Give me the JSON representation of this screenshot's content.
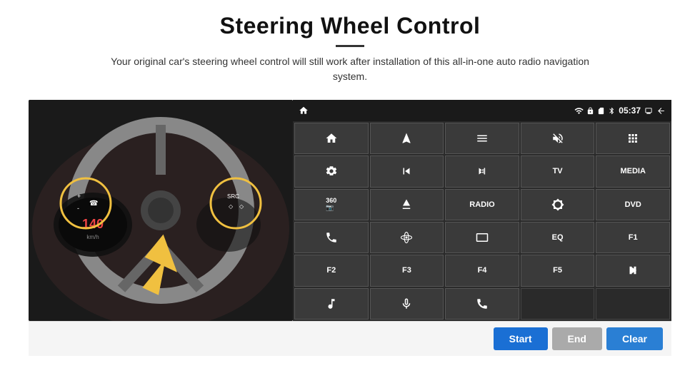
{
  "header": {
    "title": "Steering Wheel Control",
    "subtitle": "Your original car's steering wheel control will still work after installation of this all-in-one auto radio navigation system."
  },
  "status_bar": {
    "time": "05:37",
    "icons": [
      "wifi",
      "lock",
      "sim",
      "bluetooth",
      "battery",
      "screen",
      "back"
    ]
  },
  "button_grid": [
    [
      {
        "icon": "home",
        "label": "",
        "type": "icon"
      },
      {
        "icon": "navigate",
        "label": "",
        "type": "icon"
      },
      {
        "icon": "list",
        "label": "",
        "type": "icon"
      },
      {
        "icon": "mute",
        "label": "",
        "type": "icon"
      },
      {
        "icon": "apps",
        "label": "",
        "type": "icon"
      }
    ],
    [
      {
        "icon": "settings",
        "label": "",
        "type": "icon"
      },
      {
        "icon": "prev",
        "label": "",
        "type": "icon"
      },
      {
        "icon": "next",
        "label": "",
        "type": "icon"
      },
      {
        "label": "TV",
        "type": "text"
      },
      {
        "label": "MEDIA",
        "type": "text"
      }
    ],
    [
      {
        "icon": "360cam",
        "label": "",
        "type": "icon"
      },
      {
        "icon": "eject",
        "label": "",
        "type": "icon"
      },
      {
        "label": "RADIO",
        "type": "text"
      },
      {
        "icon": "brightness",
        "label": "",
        "type": "icon"
      },
      {
        "label": "DVD",
        "type": "text"
      }
    ],
    [
      {
        "icon": "phone",
        "label": "",
        "type": "icon"
      },
      {
        "icon": "orbit",
        "label": "",
        "type": "icon"
      },
      {
        "icon": "screen2",
        "label": "",
        "type": "icon"
      },
      {
        "label": "EQ",
        "type": "text"
      },
      {
        "label": "F1",
        "type": "text"
      }
    ],
    [
      {
        "label": "F2",
        "type": "text"
      },
      {
        "label": "F3",
        "type": "text"
      },
      {
        "label": "F4",
        "type": "text"
      },
      {
        "label": "F5",
        "type": "text"
      },
      {
        "icon": "playpause",
        "label": "",
        "type": "icon"
      }
    ],
    [
      {
        "icon": "music",
        "label": "",
        "type": "icon"
      },
      {
        "icon": "mic",
        "label": "",
        "type": "icon"
      },
      {
        "icon": "hangup",
        "label": "",
        "type": "icon"
      },
      {
        "label": "",
        "type": "empty"
      },
      {
        "label": "",
        "type": "empty"
      }
    ]
  ],
  "bottom_bar": {
    "start_label": "Start",
    "end_label": "End",
    "clear_label": "Clear"
  }
}
